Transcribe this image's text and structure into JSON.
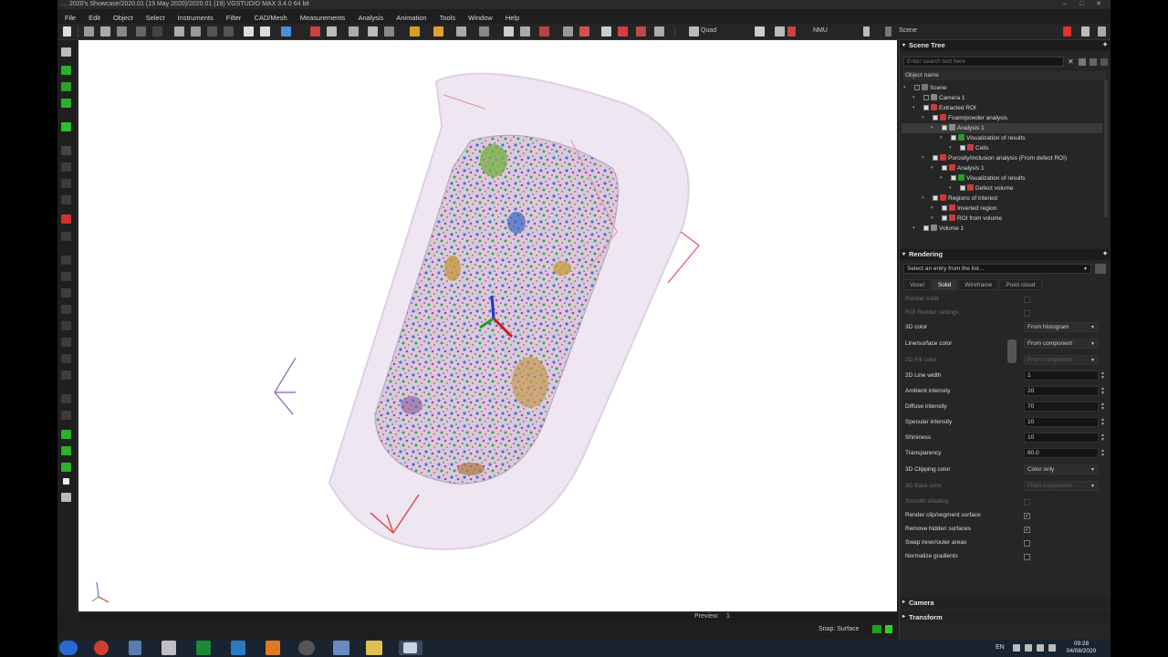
{
  "window": {
    "title": "… 2020’s Showcase/2020.01 (19 May 2020)/2020.01 (19) VGSTUDIO MAX 3.4.0 64 bit"
  },
  "menu": [
    "File",
    "Edit",
    "Object",
    "Select",
    "Instruments",
    "Filter",
    "CAD/Mesh",
    "Measurements",
    "Analysis",
    "Animation",
    "Tools",
    "Window",
    "Help"
  ],
  "toolbar": {
    "layout_label": "Quad",
    "unit_label": "NMU",
    "scene_label": "Scene"
  },
  "scene_tree": {
    "title": "Scene Tree",
    "search_placeholder": "Enter search text here",
    "column_header": "Object name",
    "items": [
      {
        "label": "Scene",
        "indent": 0
      },
      {
        "label": "Camera 1",
        "indent": 1
      },
      {
        "label": "Extracted ROI",
        "indent": 1
      },
      {
        "label": "Foam/powder analysis",
        "indent": 2
      },
      {
        "label": "Analysis 1",
        "indent": 3
      },
      {
        "label": "Visualization of results",
        "indent": 4
      },
      {
        "label": "Cells",
        "indent": 5
      },
      {
        "label": "Porosity/inclusion analysis (From defect ROI)",
        "indent": 2
      },
      {
        "label": "Analysis 1",
        "indent": 3
      },
      {
        "label": "Visualization of results",
        "indent": 4
      },
      {
        "label": "Defect volume",
        "indent": 5
      },
      {
        "label": "Regions of interest",
        "indent": 2
      },
      {
        "label": "Inverted region",
        "indent": 3
      },
      {
        "label": "ROI from volume",
        "indent": 3
      },
      {
        "label": "Volume 1",
        "indent": 1
      }
    ]
  },
  "rendering": {
    "title": "Rendering",
    "preset_placeholder": "Select an entry from the list...",
    "tabs": [
      "Voxel",
      "Solid",
      "Wireframe",
      "Point cloud"
    ],
    "active_tab": "Solid",
    "props": [
      {
        "label": "Render solid",
        "type": "check",
        "dim": true,
        "checked": false
      },
      {
        "label": "ROI Render settings",
        "type": "check",
        "dim": true,
        "checked": false
      },
      {
        "label": "3D color",
        "type": "combo",
        "value": "From histogram"
      },
      {
        "label": "Line/surface color",
        "type": "combo",
        "value": "From component"
      },
      {
        "label": "2D Fill color",
        "type": "combo",
        "value": "From component",
        "dim": true
      },
      {
        "label": "2D Line width",
        "type": "num",
        "value": "1"
      },
      {
        "label": "Ambient intensity",
        "type": "num",
        "value": "20"
      },
      {
        "label": "Diffuse intensity",
        "type": "num",
        "value": "70"
      },
      {
        "label": "Specular intensity",
        "type": "num",
        "value": "10"
      },
      {
        "label": "Shininess",
        "type": "num",
        "value": "10"
      },
      {
        "label": "Transparency",
        "type": "num",
        "value": "80.0"
      },
      {
        "label": "3D Clipping color",
        "type": "combo",
        "value": "Color only"
      },
      {
        "label": "3D Back color",
        "type": "combo",
        "value": "From component",
        "dim": true
      },
      {
        "label": "Smooth shading",
        "type": "check",
        "dim": true,
        "checked": false
      },
      {
        "label": "Render clip/segment surface",
        "type": "check",
        "checked": true
      },
      {
        "label": "Remove hidden surfaces",
        "type": "check",
        "checked": true
      },
      {
        "label": "Swap inner/outer areas",
        "type": "check",
        "checked": false
      },
      {
        "label": "Normalize gradients",
        "type": "check",
        "checked": false
      }
    ]
  },
  "sections": {
    "camera": "Camera",
    "transform": "Transform"
  },
  "status": {
    "preview_label": "Preview:",
    "preview_value": "1",
    "snap_label": "Snap: Surface"
  },
  "taskbar": {
    "language": "EN",
    "time": "09:28",
    "date": "04/08/2020"
  },
  "colors": {
    "accent_red": "#e03030",
    "green_icon": "#1aa31a",
    "panel_bg": "#262626"
  }
}
